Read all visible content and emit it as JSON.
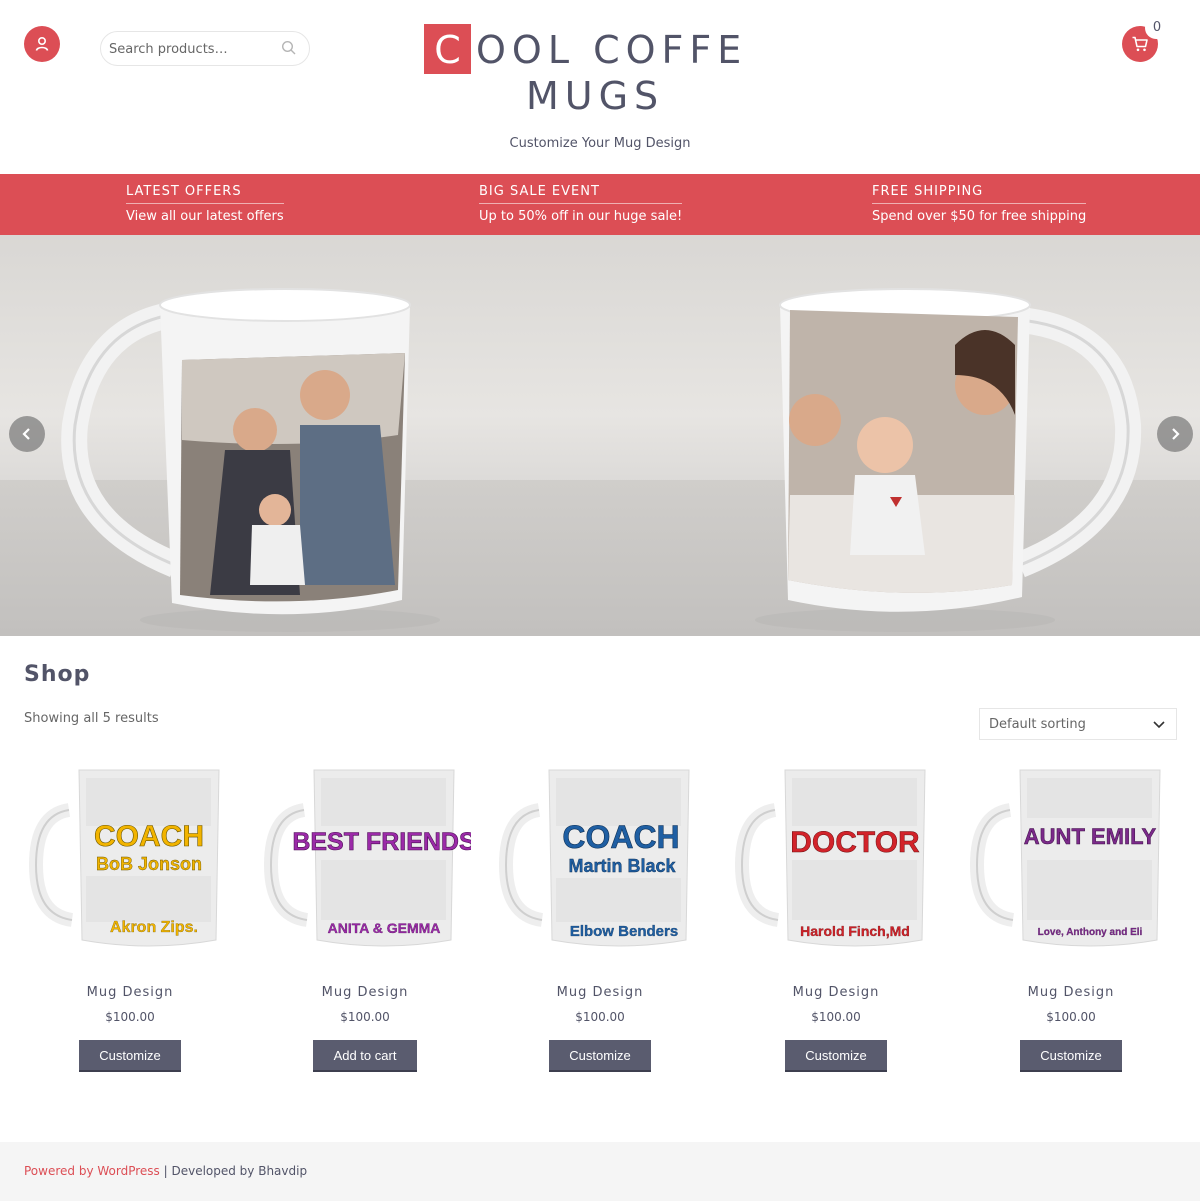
{
  "header": {
    "search_placeholder": "Search products…",
    "logo_initial": "C",
    "logo_line1": "OOL COFFE",
    "logo_line2": "MUGS",
    "tagline": "Customize Your Mug Design",
    "cart_count": "0"
  },
  "promo": [
    {
      "title": "LATEST OFFERS",
      "text": "View all our latest offers"
    },
    {
      "title": "BIG SALE EVENT",
      "text": "Up to 50% off in our huge sale!"
    },
    {
      "title": "FREE SHIPPING",
      "text": "Spend over $50 for free shipping"
    }
  ],
  "shop": {
    "title": "Shop",
    "result_count": "Showing all 5 results",
    "sorting": "Default sorting"
  },
  "products": [
    {
      "name": "Mug Design",
      "price": "$100.00",
      "button": "Customize",
      "mug_title": "COACH",
      "mug_name": "BoB Jonson",
      "mug_footer": "Akron Zips.",
      "title_color": "#f2b400",
      "name_color": "#f2b400"
    },
    {
      "name": "Mug Design",
      "price": "$100.00",
      "button": "Add to cart",
      "mug_title": "BEST FRIENDS",
      "mug_name": "",
      "mug_footer": "ANITA & GEMMA",
      "title_color": "#9b2aa8",
      "name_color": "#9b2aa8"
    },
    {
      "name": "Mug Design",
      "price": "$100.00",
      "button": "Customize",
      "mug_title": "COACH",
      "mug_name": "Martin Black",
      "mug_footer": "Elbow Benders",
      "title_color": "#1f5fa3",
      "name_color": "#1f5fa3"
    },
    {
      "name": "Mug Design",
      "price": "$100.00",
      "button": "Customize",
      "mug_title": "DOCTOR",
      "mug_name": "",
      "mug_footer": "Harold Finch,Md",
      "title_color": "#d2232a",
      "name_color": "#d2232a"
    },
    {
      "name": "Mug Design",
      "price": "$100.00",
      "button": "Customize",
      "mug_title": "AUNT EMILY",
      "mug_name": "",
      "mug_footer": "Love, Anthony and Eli",
      "title_color": "#7b2a8a",
      "name_color": "#7b2a8a"
    }
  ],
  "footer": {
    "powered_by": "Powered by WordPress",
    "separator": " | ",
    "developed_by": "Developed by Bhavdip"
  },
  "colors": {
    "accent": "#dc4e55",
    "button": "#5a5c6f",
    "text": "#525468"
  }
}
